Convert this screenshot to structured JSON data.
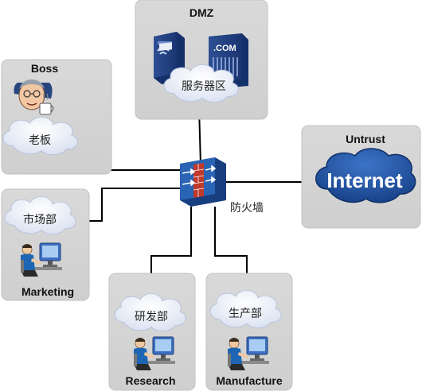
{
  "zones": {
    "dmz": {
      "title": "DMZ",
      "cloud_label": "服务器区",
      "server_badge": ".COM"
    },
    "boss": {
      "title": "Boss",
      "cloud_label": "老板"
    },
    "marketing": {
      "title": "Marketing",
      "cloud_label": "市场部"
    },
    "research": {
      "title": "Research",
      "cloud_label": "研发部"
    },
    "manufacture": {
      "title": "Manufacture",
      "cloud_label": "生产部"
    },
    "untrust": {
      "title": "Untrust",
      "cloud_label": "Internet"
    }
  },
  "firewall": {
    "label": "防火墙"
  },
  "colors": {
    "zone_bg": "#d6d6d6",
    "zone_border": "#c4c4c4",
    "cloud_fill": "#eef2fa",
    "internet_blue": "#1f4f9e",
    "line": "#000000",
    "firewall_blue": "#2a64b4",
    "firewall_red": "#c0392b"
  },
  "icons": {
    "dmz": [
      "server-icon",
      "web-server-icon"
    ],
    "boss": "boss-icon",
    "users": "user-at-computer-icon",
    "firewall": "firewall-icon"
  }
}
